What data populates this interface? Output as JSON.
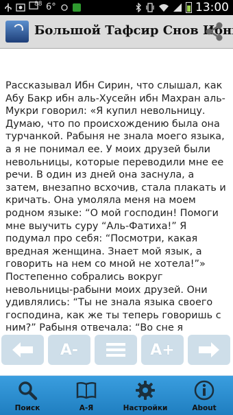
{
  "status_bar": {
    "notification_count": "88",
    "temperature": "6°",
    "time": "13:00",
    "icons": [
      "usb-icon",
      "screenshot-icon",
      "notification-badge-icon",
      "weather-icon",
      "app-icon",
      "bluetooth-icon",
      "vibrate-icon",
      "wifi-icon",
      "signal-icon",
      "battery-icon"
    ]
  },
  "app_bar": {
    "title": "Большой Тафсир Снов Ибнг",
    "share_icon": "share-icon"
  },
  "article": {
    "text": "Рассказывал Ибн Сирин, что слышал, как Абу Бакр ибн аль-Хусейн ибн Махран аль-Мукри говорил: «Я купил невольницу. Думаю, что по происхождению была она турчанкой. Рабыня не знала моего языка, а я не понимал ее. У моих друзей были невольницы, которые переводили мне ее речи. В один из дней она заснула, а затем, внезапно всхочив, стала плакать и кричать. Она умоляла меня на моем родном языке: “О мой господин! Помоги мне выучить суру “Аль-Фатиха!” Я подумал про себя: “Посмотри, какая вредная женщина. Знает мой язык, а говорить на нем со мной не хотела!”» Постепенно собрались вокруг невольницы-рабыни моих друзей. Они удивлялись: “Ты не знала языка своего господина, как же ты теперь говоришь с ним?” Рабыня отвечала: “Во сне я увидела разгневанного человека. Он куда-то шел. За ним двигалась большая толпа. Я"
  },
  "toolbar": {
    "buttons": [
      {
        "name": "prev-page-button",
        "icon": "arrow-left-icon",
        "label": ""
      },
      {
        "name": "decrease-font-button",
        "icon": "font-decrease-icon",
        "label": "A-"
      },
      {
        "name": "menu-button",
        "icon": "menu-icon",
        "label": ""
      },
      {
        "name": "increase-font-button",
        "icon": "font-increase-icon",
        "label": "A+"
      },
      {
        "name": "next-page-button",
        "icon": "arrow-right-icon",
        "label": ""
      }
    ]
  },
  "bottom_nav": {
    "items": [
      {
        "label": "Поиск",
        "icon": "search-icon"
      },
      {
        "label": "А-Я",
        "icon": "book-icon"
      },
      {
        "label": "Настройки",
        "icon": "gear-icon"
      },
      {
        "label": "About",
        "icon": "info-icon"
      }
    ]
  },
  "colors": {
    "app_bar_bg": "#dcdcdc",
    "bottom_nav_bg": "#2d8fd1",
    "toolbar_button_bg": "#a5c3d7",
    "text": "#222222"
  }
}
